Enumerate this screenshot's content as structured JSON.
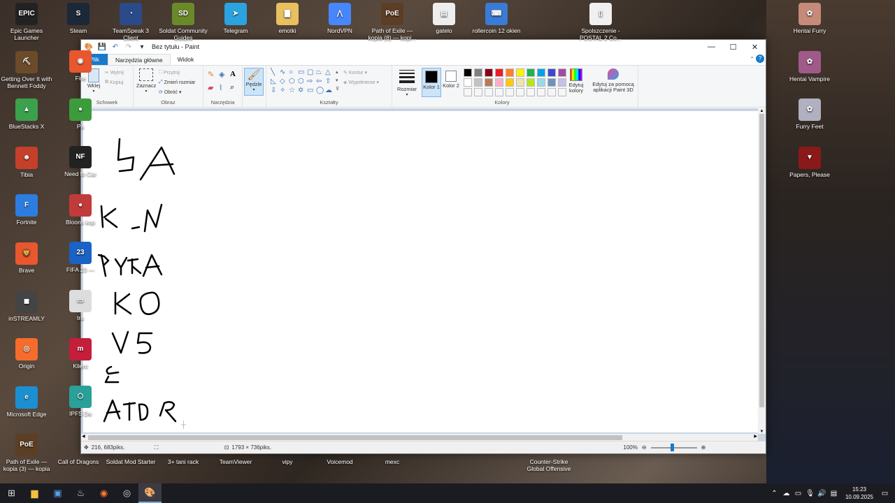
{
  "desktop": {
    "icons_left": [
      {
        "label": "Epic Games Launcher",
        "color": "#222222",
        "glyph": "EPIC"
      },
      {
        "label": "Getting Over It with Bennett Foddy",
        "color": "#6b4b2a",
        "glyph": "⛏"
      },
      {
        "label": "BlueStacks X",
        "color": "#3ca14d",
        "glyph": "▲"
      },
      {
        "label": "Tibia",
        "color": "#c4402a",
        "glyph": "☻"
      },
      {
        "label": "Fortnite",
        "color": "#2d7de0",
        "glyph": "F"
      },
      {
        "label": "Brave",
        "color": "#e8572e",
        "glyph": "🦁"
      },
      {
        "label": "inSTREAMLY",
        "color": "#444444",
        "glyph": "◼"
      },
      {
        "label": "Origin",
        "color": "#f56c2d",
        "glyph": "◎"
      },
      {
        "label": "Microsoft Edge",
        "color": "#1c8fd1",
        "glyph": "e"
      },
      {
        "label": "Path of Exile — kopia (3) — kopia",
        "color": "#5b3e24",
        "glyph": "PoE"
      }
    ],
    "icons_col2": [
      {
        "label": "Fire",
        "color": "#e8572e",
        "glyph": "◉"
      },
      {
        "label": "Pa",
        "color": "#3c9c3c",
        "glyph": "●"
      },
      {
        "label": "Need fo Car",
        "color": "#222222",
        "glyph": "NF"
      },
      {
        "label": "Bloons kop",
        "color": "#c23b3b",
        "glyph": "●"
      },
      {
        "label": "FIFA 23 —",
        "color": "#1a62c4",
        "glyph": "23"
      },
      {
        "label": "tra",
        "color": "#dddddd",
        "glyph": "▭"
      },
      {
        "label": "Klient",
        "color": "#c41e3a",
        "glyph": "m"
      },
      {
        "label": "IPFS De",
        "color": "#2aa198",
        "glyph": "⬡"
      }
    ],
    "icons_top": [
      {
        "label": "Steam",
        "color": "#1b2838",
        "glyph": "S"
      },
      {
        "label": "TeamSpeak 3 Client",
        "color": "#2a4a8a",
        "glyph": "◔"
      },
      {
        "label": "Soldat Community Guides",
        "color": "#6a8a2a",
        "glyph": "SD"
      },
      {
        "label": "Telegram",
        "color": "#2aa3e0",
        "glyph": "➤"
      },
      {
        "label": "emotki",
        "color": "#e8c060",
        "glyph": "▇"
      },
      {
        "label": "NordVPN",
        "color": "#4687ff",
        "glyph": "⋀"
      },
      {
        "label": "Path of Exile — kopia (8) — kopi...",
        "color": "#5b3e24",
        "glyph": "PoE"
      },
      {
        "label": "gatelo",
        "color": "#eeeeee",
        "glyph": "▤"
      },
      {
        "label": "rollercoin 12 okien",
        "color": "#3a7bd5",
        "glyph": "⌨"
      },
      {
        "label": "Spolszczenie - POSTAL 2 Co...",
        "color": "#f0f0f0",
        "glyph": "▯"
      }
    ],
    "icons_right": [
      {
        "label": "Hentai Furry",
        "color": "#c58a7a",
        "glyph": "✿"
      },
      {
        "label": "Hentai Vampire",
        "color": "#a05a8a",
        "glyph": "✿"
      },
      {
        "label": "Furry Feet",
        "color": "#b0b0c0",
        "glyph": "✿"
      },
      {
        "label": "Papers, Please",
        "color": "#8a1a1a",
        "glyph": "▼"
      }
    ],
    "icons_bottom": [
      {
        "label": "Call of Dragons"
      },
      {
        "label": "Soldat Mod Starter"
      },
      {
        "label": "3+ tani rack"
      },
      {
        "label": "TeamViewer"
      },
      {
        "label": "vipy"
      },
      {
        "label": "Voicemod"
      },
      {
        "label": "mexc"
      },
      {
        "label": "Counter-Strike Global Offensive"
      }
    ]
  },
  "window": {
    "title": "Bez tytułu - Paint",
    "tabs": {
      "file": "Plik",
      "home": "Narzędzia główne",
      "view": "Widok"
    },
    "clipboard": {
      "paste": "Wklej",
      "cut": "Wytnij",
      "copy": "Kopiuj",
      "label": "Schowek"
    },
    "image": {
      "select": "Zaznacz",
      "crop": "Przytnij",
      "resize": "Zmień rozmiar",
      "rotate": "Obróć",
      "label": "Obraz"
    },
    "tools": {
      "label": "Narzędzia"
    },
    "brushes": {
      "label": "Pędzle"
    },
    "shapes": {
      "outline": "Kontur",
      "fill": "Wypełnienie",
      "label": "Kształty"
    },
    "size": {
      "label": "Rozmiar"
    },
    "color1": {
      "label": "Kolor 1"
    },
    "color2": {
      "label": "Kolor 2"
    },
    "colors": {
      "label": "Kolory",
      "edit": "Edytuj kolory",
      "paint3d": "Edytuj za pomocą aplikacji Paint 3D"
    },
    "palette_top": [
      "#000000",
      "#7f7f7f",
      "#880015",
      "#ed1c24",
      "#ff7f27",
      "#fff200",
      "#22b14c",
      "#00a2e8",
      "#3f48cc",
      "#a349a4"
    ],
    "palette_bottom": [
      "#ffffff",
      "#c3c3c3",
      "#b97a57",
      "#ffaec9",
      "#ffc90e",
      "#efe4b0",
      "#b5e61d",
      "#99d9ea",
      "#7092be",
      "#c8bfe7"
    ],
    "palette_empty_rows": 1,
    "status": {
      "cursor": "216, 683piks.",
      "dimensions": "1793 × 736piks.",
      "zoom": "100%"
    }
  },
  "taskbar": {
    "time": "15:23",
    "date": "10.09.2025"
  }
}
